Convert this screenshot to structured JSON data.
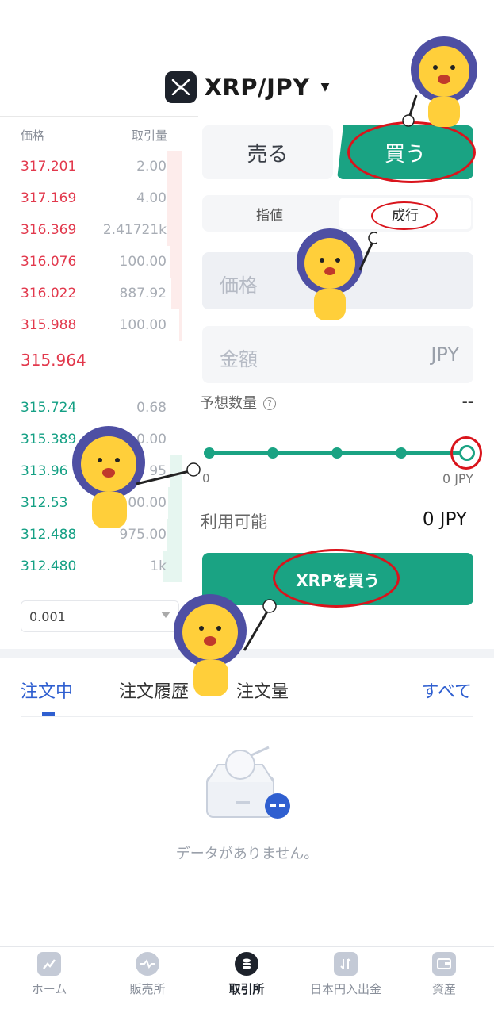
{
  "header": {
    "pair": "XRP/JPY",
    "logo_icon": "xrp-icon",
    "caret_icon": "caret-down-icon"
  },
  "orderbook": {
    "price_header": "価格",
    "qty_header": "取引量",
    "asks": [
      {
        "price": "317.201",
        "qty": "2.00"
      },
      {
        "price": "317.169",
        "qty": "4.00"
      },
      {
        "price": "316.369",
        "qty": "2.41721k"
      },
      {
        "price": "316.076",
        "qty": "100.00"
      },
      {
        "price": "316.022",
        "qty": "887.92"
      },
      {
        "price": "315.988",
        "qty": "100.00"
      }
    ],
    "mid_price": "315.964",
    "bids": [
      {
        "price": "315.724",
        "qty": "0.68"
      },
      {
        "price": "315.389",
        "qty": "0.00"
      },
      {
        "price": "313.96",
        "qty": "95"
      },
      {
        "price": "312.53",
        "qty": "00.00"
      },
      {
        "price": "312.488",
        "qty": "975.00"
      },
      {
        "price": "312.480",
        "qty": "1k"
      }
    ],
    "step": "0.001"
  },
  "trade": {
    "sell": "売る",
    "buy": "買う",
    "limit": "指値",
    "market": "成行",
    "price_placeholder": "価格",
    "amount_placeholder": "金額",
    "amount_unit": "JPY",
    "est_label": "予想数量",
    "est_value": "--",
    "slider_min": "0",
    "slider_max": "0 JPY",
    "slider_level_percent": 100,
    "avail_label": "利用可能",
    "avail_value": "0 JPY",
    "submit": "XRPを買う"
  },
  "orders": {
    "tabs": [
      "注文中",
      "注文履歴",
      "注文量"
    ],
    "see_all": "すべて",
    "empty": "データがありません。"
  },
  "nav": [
    {
      "label": "ホーム",
      "icon": "home-icon"
    },
    {
      "label": "販売所",
      "icon": "exchange-icon"
    },
    {
      "label": "取引所",
      "icon": "coins-icon"
    },
    {
      "label": "日本円入出金",
      "icon": "transfer-icon"
    },
    {
      "label": "資産",
      "icon": "wallet-icon"
    }
  ],
  "colors": {
    "accent_green": "#1aa383",
    "ask_red": "#e2384c",
    "bid_green": "#14a084",
    "link_blue": "#2f5fd0",
    "annotation_red": "#d9141c"
  }
}
